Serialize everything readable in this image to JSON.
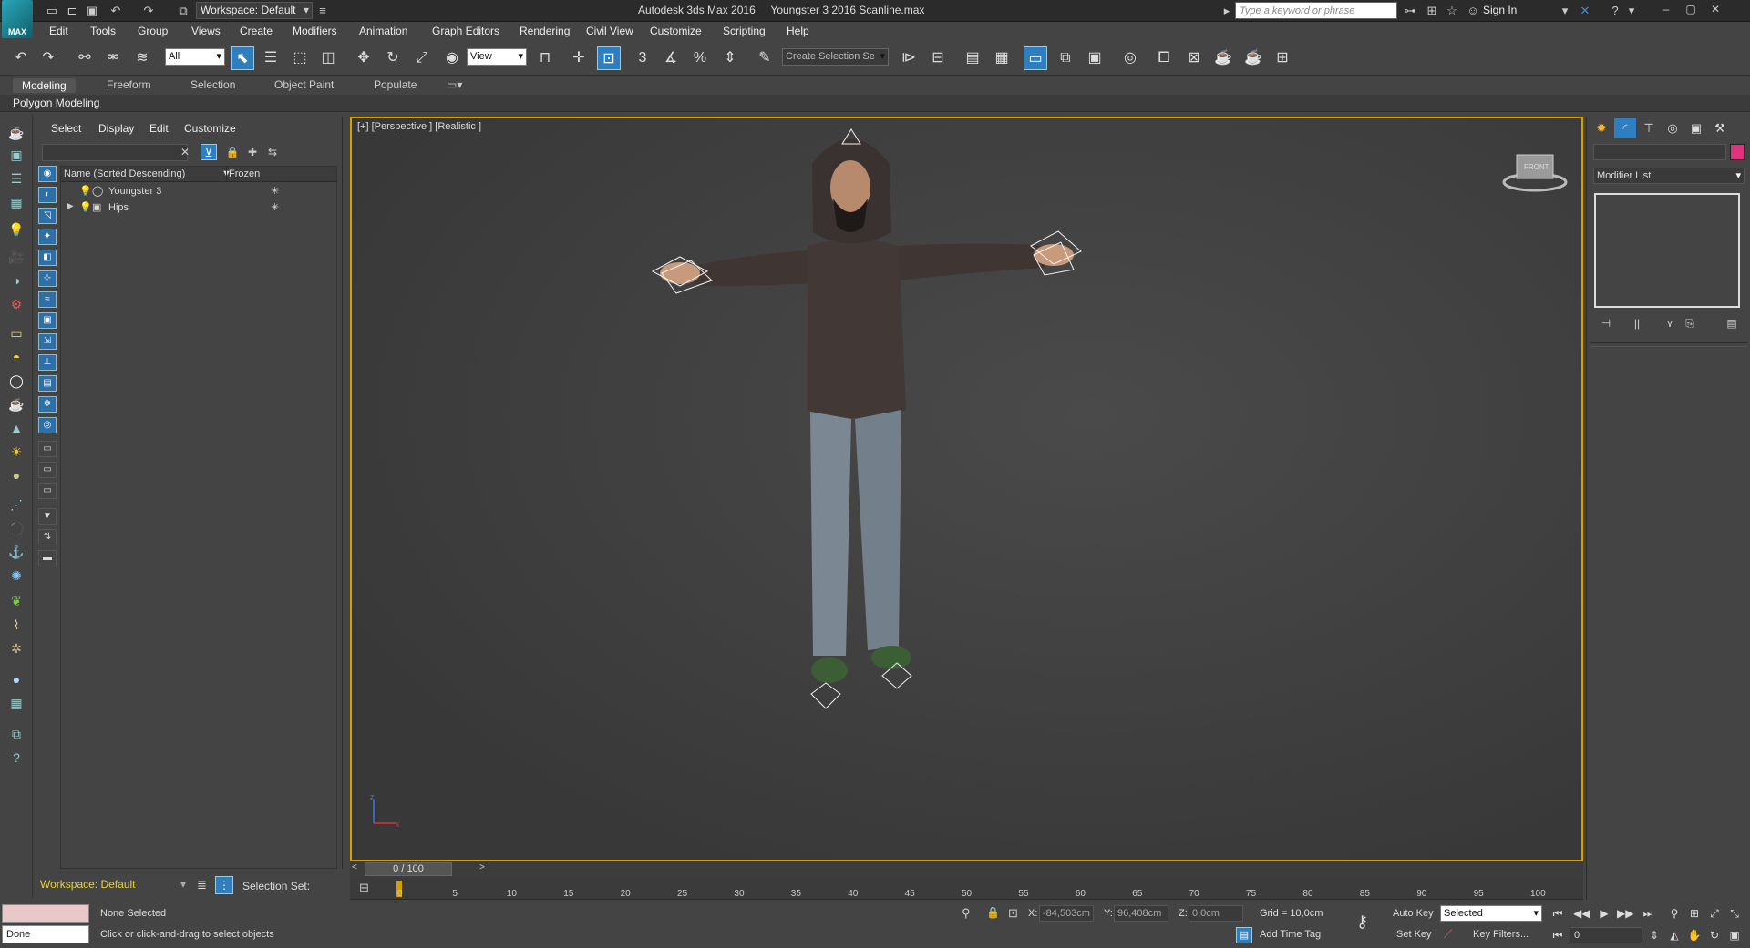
{
  "titlebar": {
    "workspace": "Workspace: Default",
    "app_name": "Autodesk 3ds Max 2016",
    "file_name": "Youngster 3 2016 Scanline.max",
    "search_placeholder": "Type a keyword or phrase",
    "sign_in": "Sign In",
    "logo_text": "MAX"
  },
  "menu": [
    "Edit",
    "Tools",
    "Group",
    "Views",
    "Create",
    "Modifiers",
    "Animation",
    "Graph Editors",
    "Rendering",
    "Civil View",
    "Customize",
    "Scripting",
    "Help"
  ],
  "toolbar": {
    "filter_value": "All",
    "ref_coord_value": "View",
    "selection_set_placeholder": "Create Selection Se",
    "snap_3": "3",
    "percent_snap": "%"
  },
  "ribbon": {
    "tabs": [
      "Modeling",
      "Freeform",
      "Selection",
      "Object Paint",
      "Populate"
    ],
    "panel_label": "Polygon Modeling"
  },
  "scene_explorer": {
    "menus": [
      "Select",
      "Display",
      "Edit",
      "Customize"
    ],
    "columns": [
      "Name (Sorted Descending)",
      "Frozen"
    ],
    "rows": [
      {
        "name": "Youngster 3",
        "frozen": "✳"
      },
      {
        "name": "Hips",
        "frozen": "✳"
      }
    ],
    "footer_workspace": "Workspace: Default",
    "selection_set_label": "Selection Set:"
  },
  "viewport": {
    "label": "[+] [Perspective ] [Realistic ]",
    "viewcube_label": "FRONT"
  },
  "command_panel": {
    "modifier_list": "Modifier List",
    "name_color": "#e0337f"
  },
  "timeline": {
    "slider_text": "0 / 100",
    "ticks": [
      5,
      10,
      15,
      20,
      25,
      30,
      35,
      40,
      45,
      50,
      55,
      60,
      65,
      70,
      75,
      80,
      85,
      90,
      95,
      100
    ],
    "first_tick": "0"
  },
  "status": {
    "done": "Done",
    "selection": "None Selected",
    "prompt": "Click or click-and-drag to select objects",
    "x_label": "X:",
    "x_value": "-84,503cm",
    "y_label": "Y:",
    "y_value": "96,408cm",
    "z_label": "Z:",
    "z_value": "0,0cm",
    "grid": "Grid = 10,0cm",
    "add_time_tag": "Add Time Tag",
    "auto_key": "Auto Key",
    "set_key": "Set Key",
    "key_mode_value": "Selected",
    "key_filters": "Key Filters...",
    "current_frame": "0"
  }
}
